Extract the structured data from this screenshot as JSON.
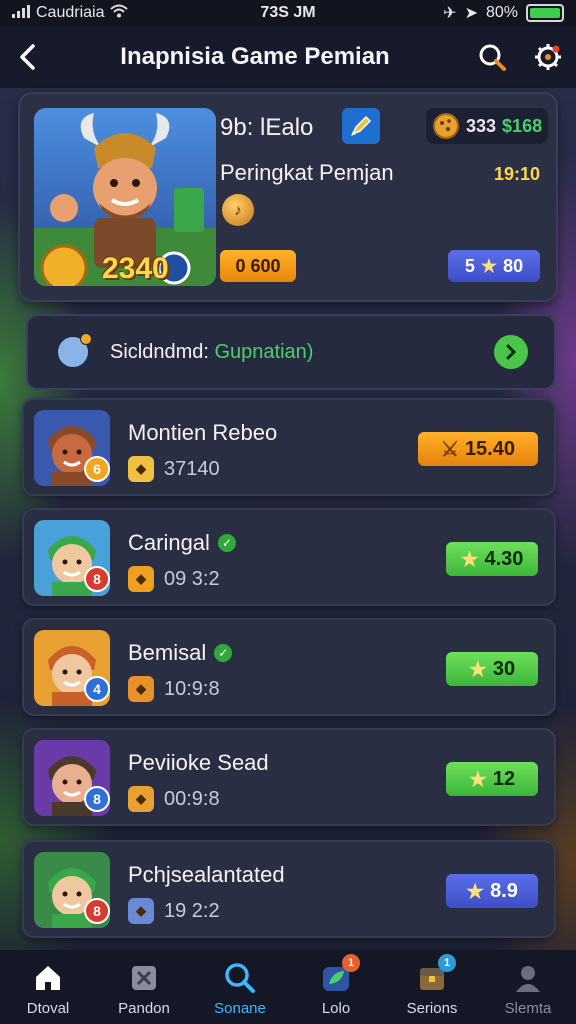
{
  "status_bar": {
    "carrier": "Caudriaia",
    "time": "73S JM",
    "battery": "80%"
  },
  "header": {
    "title": "Inapnisia Game Pemian",
    "back_icon": "back-arrow-icon",
    "search_icon": "search-icon",
    "settings_icon": "gear-icon"
  },
  "profile": {
    "name": "9b: lEalo",
    "coins_a": "333",
    "coins_b": "$168",
    "rank_label": "Peringkat Pemjan",
    "rank_time": "19:10",
    "avatar_score": "2340",
    "gold_value": "0 600",
    "stars_left": "5",
    "stars_right": "80"
  },
  "schedule": {
    "label": "Sicldndmd:",
    "value": "Gupnatian)"
  },
  "rows": [
    {
      "name": "Montien Rebeo",
      "meta": "37140",
      "score": "15.40",
      "level": "6",
      "style": "orange",
      "verified": false,
      "level_color": "#f0a61e"
    },
    {
      "name": "Caringal",
      "meta": "09 3:2",
      "score": "4.30",
      "level": "8",
      "style": "green",
      "verified": true,
      "level_color": "#d83a2e"
    },
    {
      "name": "Bemisal",
      "meta": "10:9:8",
      "score": "30",
      "level": "4",
      "style": "green",
      "verified": true,
      "level_color": "#2f6fd8"
    },
    {
      "name": "Peviioke Sead",
      "meta": "00:9:8",
      "score": "12",
      "level": "8",
      "style": "green",
      "verified": false,
      "level_color": "#2f6fd8"
    },
    {
      "name": "Pchjsealantated",
      "meta": "19 2:2",
      "score": "8.9",
      "level": "8",
      "style": "blue",
      "verified": false,
      "level_color": "#d83a2e"
    }
  ],
  "nav": [
    {
      "label": "Dtoval",
      "icon": "home-icon",
      "badge": ""
    },
    {
      "label": "Pandon",
      "icon": "shield-icon",
      "badge": ""
    },
    {
      "label": "Sonane",
      "icon": "search-icon",
      "badge": ""
    },
    {
      "label": "Lolo",
      "icon": "leaf-icon",
      "badge": "1"
    },
    {
      "label": "Serions",
      "icon": "chest-icon",
      "badge": "1"
    },
    {
      "label": "Slemta",
      "icon": "user-icon",
      "badge": ""
    }
  ],
  "colors": {
    "accent_blue": "#3fb6ff",
    "gold": "#ffd84a",
    "green": "#4ad06a",
    "orange": "#f0a61e"
  }
}
